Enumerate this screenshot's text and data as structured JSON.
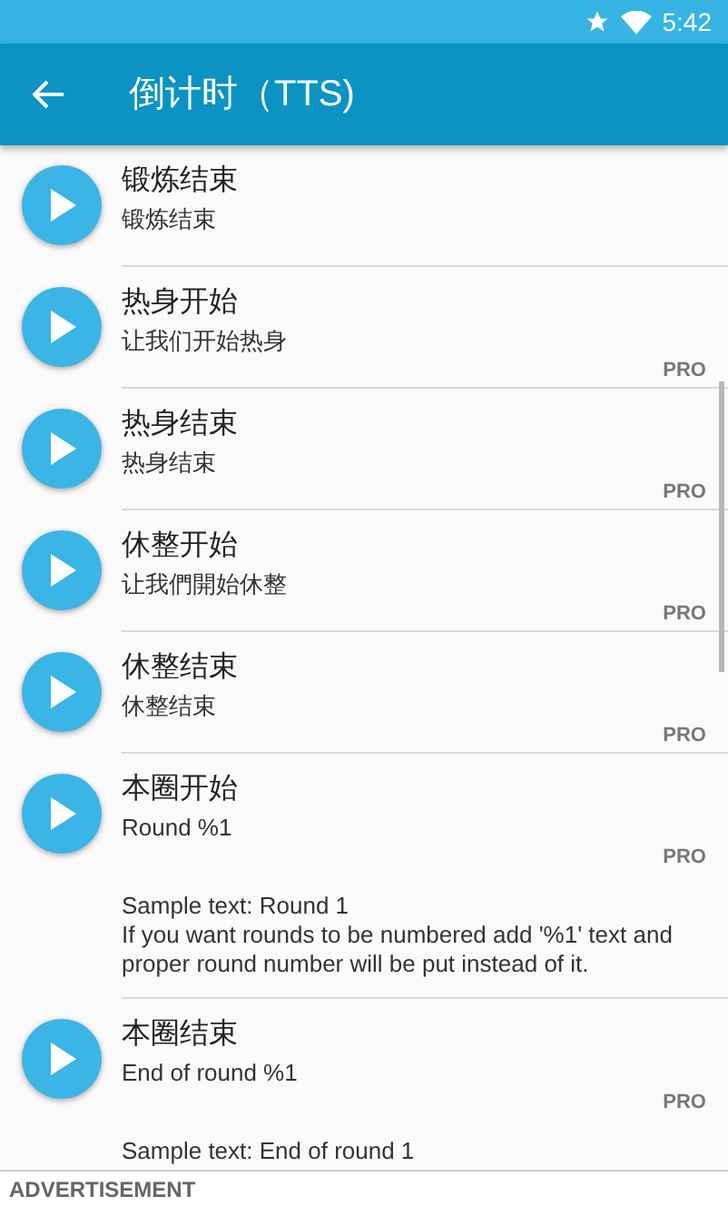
{
  "status_bar": {
    "time": "5:42"
  },
  "toolbar": {
    "title": "倒计时（TTS)"
  },
  "items": [
    {
      "title": "锻炼结束",
      "text": "锻炼结束"
    },
    {
      "title": "热身开始",
      "text": "让我们开始热身",
      "badge": "PRO"
    },
    {
      "title": "热身结束",
      "text": "热身结束",
      "badge": "PRO"
    },
    {
      "title": "休整开始",
      "text": "让我們開始休整",
      "badge": "PRO"
    },
    {
      "title": "休整结束",
      "text": "休整结束",
      "badge": "PRO"
    },
    {
      "title": "本圈开始",
      "text": "Round %1",
      "badge": "PRO",
      "sample": [
        "Sample text: Round 1",
        "If you want rounds to be numbered add '%1' text and proper round number will be put instead of it."
      ]
    },
    {
      "title": "本圈结束",
      "text": "End of round %1",
      "badge": "PRO",
      "sample": [
        "Sample text: End of round 1"
      ]
    }
  ],
  "ad_bar": {
    "label": "ADVERTISEMENT"
  }
}
